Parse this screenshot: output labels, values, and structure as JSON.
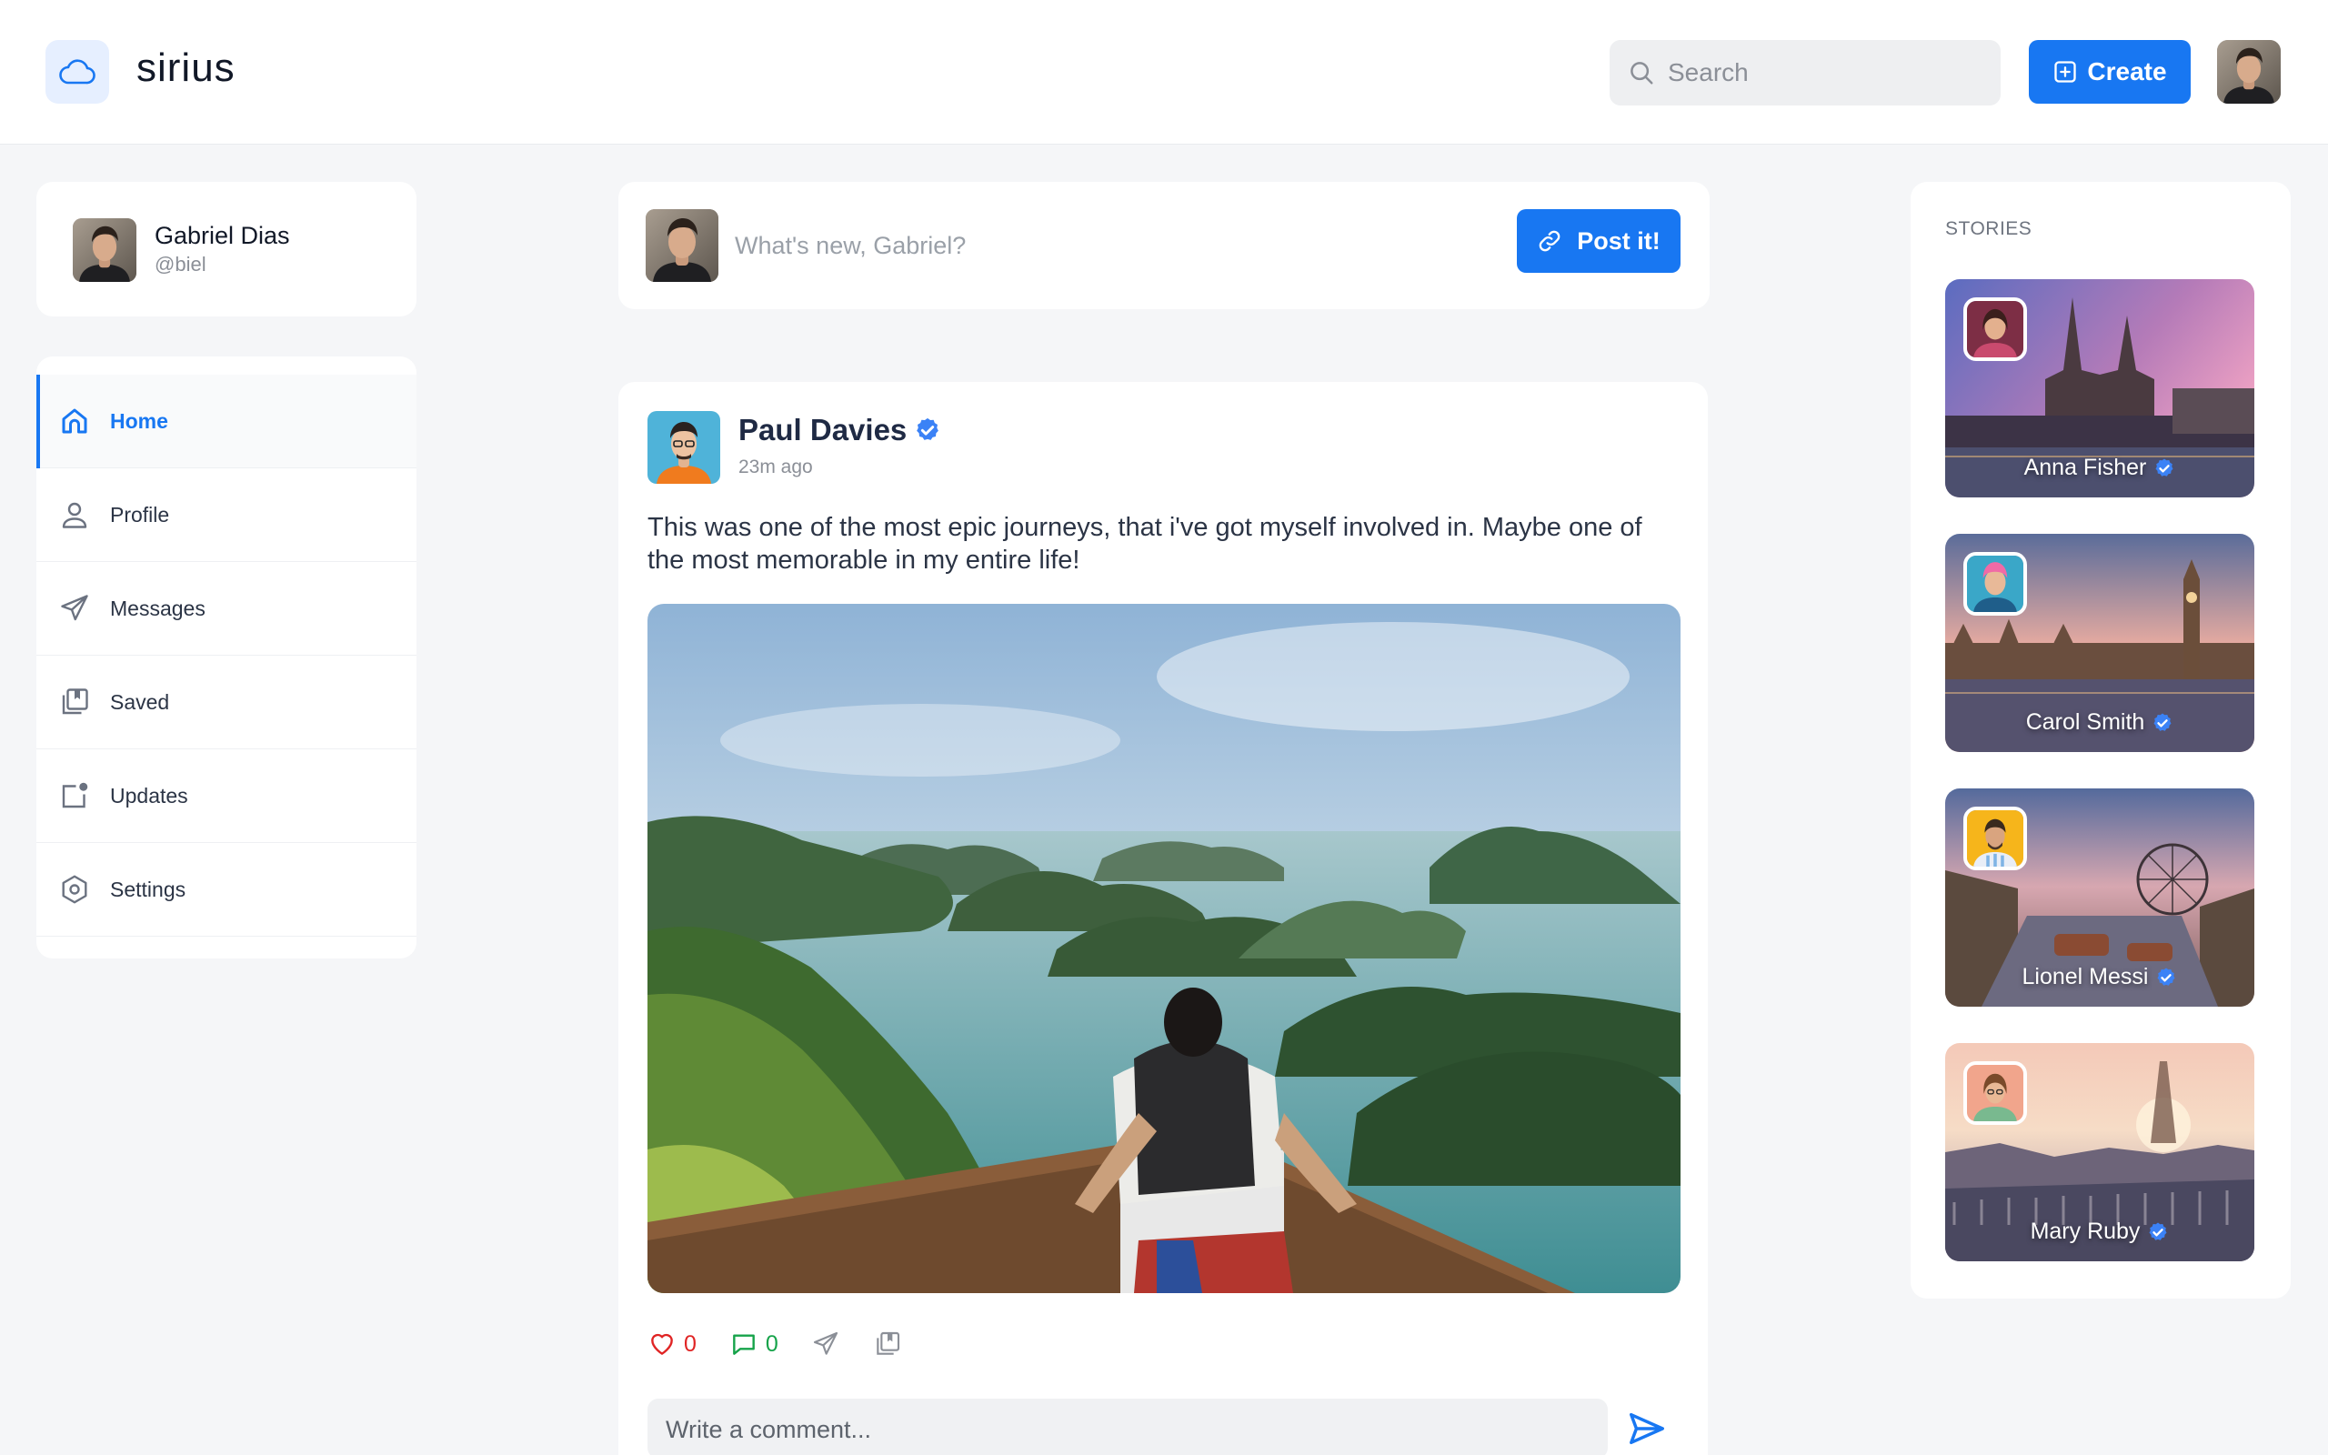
{
  "app": {
    "brand": "sirius",
    "accent": "#1877f2"
  },
  "header": {
    "search_placeholder": "Search",
    "create_label": "Create"
  },
  "profile": {
    "name": "Gabriel Dias",
    "handle": "@biel"
  },
  "nav": {
    "items": [
      {
        "label": "Home",
        "icon": "home-icon",
        "active": true
      },
      {
        "label": "Profile",
        "icon": "user-icon"
      },
      {
        "label": "Messages",
        "icon": "send-icon"
      },
      {
        "label": "Saved",
        "icon": "bookmark-icon"
      },
      {
        "label": "Updates",
        "icon": "notification-icon"
      },
      {
        "label": "Settings",
        "icon": "settings-icon"
      }
    ]
  },
  "composer": {
    "placeholder": "What's new, Gabriel?",
    "post_label": "Post it!"
  },
  "post": {
    "author": "Paul Davies",
    "time": "23m ago",
    "text": "This was one of the most epic journeys, that i've got myself involved in. Maybe one of the most memorable in my entire life!",
    "likes": "0",
    "comments": "0",
    "comment_placeholder": "Write a comment..."
  },
  "stories": {
    "title": "STORIES",
    "items": [
      {
        "name": "Anna Fisher"
      },
      {
        "name": "Carol Smith"
      },
      {
        "name": "Lionel Messi"
      },
      {
        "name": "Mary Ruby"
      }
    ]
  }
}
